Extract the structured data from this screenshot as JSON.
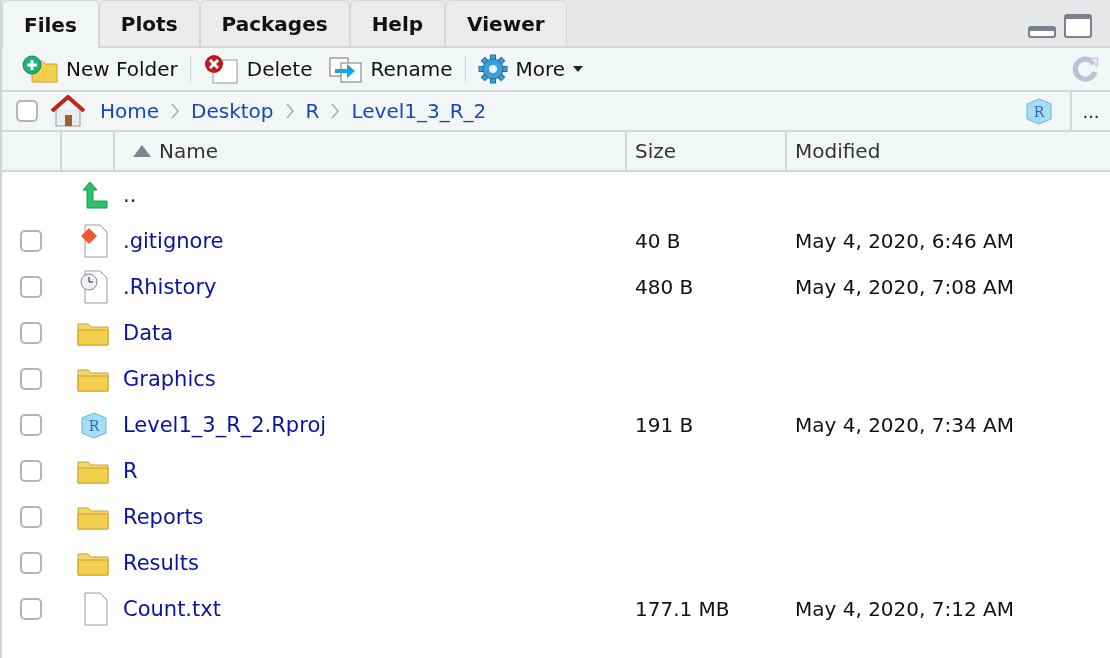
{
  "tabs": [
    {
      "label": "Files",
      "selected": true
    },
    {
      "label": "Plots",
      "selected": false
    },
    {
      "label": "Packages",
      "selected": false
    },
    {
      "label": "Help",
      "selected": false
    },
    {
      "label": "Viewer",
      "selected": false
    }
  ],
  "toolbar": [
    {
      "kind": "new-folder",
      "label": "New Folder"
    },
    {
      "kind": "delete",
      "label": "Delete"
    },
    {
      "kind": "rename",
      "label": "Rename"
    },
    {
      "kind": "more",
      "label": "More"
    }
  ],
  "breadcrumb": {
    "checked": false,
    "items": [
      "Home",
      "Desktop",
      "R",
      "Level1_3_R_2"
    ],
    "project_letter": "R",
    "more": "..."
  },
  "table": {
    "columns": [
      {
        "label": "Name",
        "sorted": true
      },
      {
        "label": "Size",
        "sorted": false
      },
      {
        "label": "Modified",
        "sorted": false
      }
    ],
    "rows": [
      {
        "kind": "parent",
        "name": ".."
      },
      {
        "kind": "git",
        "name": ".gitignore",
        "size": "40 B",
        "modified": "May 4, 2020, 6:46 AM",
        "checked": false
      },
      {
        "kind": "history",
        "name": ".Rhistory",
        "size": "480 B",
        "modified": "May 4, 2020, 7:08 AM",
        "checked": false
      },
      {
        "kind": "folder",
        "name": "Data",
        "checked": false
      },
      {
        "kind": "folder",
        "name": "Graphics",
        "checked": false
      },
      {
        "kind": "rproj",
        "name": "Level1_3_R_2.Rproj",
        "letter": "R",
        "size": "191 B",
        "modified": "May 4, 2020, 7:34 AM",
        "checked": false
      },
      {
        "kind": "folder",
        "name": "R",
        "checked": false
      },
      {
        "kind": "folder",
        "name": "Reports",
        "checked": false
      },
      {
        "kind": "folder",
        "name": "Results",
        "checked": false
      },
      {
        "kind": "text",
        "name": "Count.txt",
        "size": "177.1 MB",
        "modified": "May 4, 2020, 7:12 AM",
        "checked": false
      }
    ]
  }
}
